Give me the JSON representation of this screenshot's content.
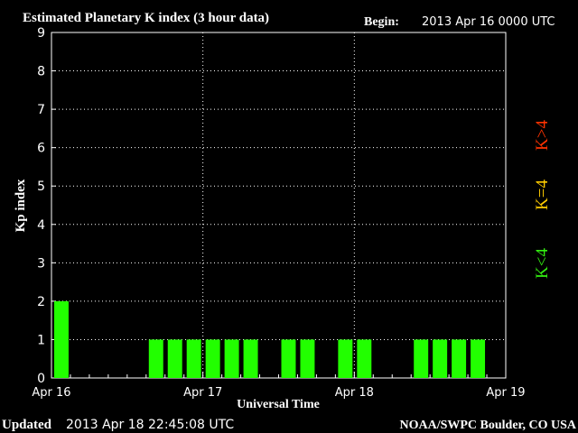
{
  "header": {
    "title": "Estimated Planetary K index (3 hour data)",
    "begin_label": "Begin:",
    "begin_value": "2013 Apr 16 0000 UTC"
  },
  "footer": {
    "updated_label": "Updated",
    "updated_value": "2013 Apr 18 22:45:08 UTC",
    "credit": "NOAA/SWPC Boulder, CO USA"
  },
  "legend": [
    {
      "label": "K>4",
      "color": "#ff3300"
    },
    {
      "label": "K=4",
      "color": "#ffcc00"
    },
    {
      "label": "K<4",
      "color": "#33ee11"
    }
  ],
  "colors": {
    "background": "#000000",
    "axes": "#ffffff",
    "grid": "#ffffff",
    "bar_low": "#22ff00"
  },
  "chart_data": {
    "type": "bar",
    "title": "Estimated Planetary K index (3 hour data)",
    "xlabel": "Universal Time",
    "ylabel": "Kp index",
    "ylim": [
      0,
      9
    ],
    "yticks": [
      "0",
      "1",
      "2",
      "3",
      "4",
      "5",
      "6",
      "7",
      "8",
      "9"
    ],
    "xticks": [
      "Apr 16",
      "Apr 17",
      "Apr 18",
      "Apr 19"
    ],
    "grid": true,
    "bins_per_day": 8,
    "values": [
      2,
      null,
      null,
      null,
      null,
      1,
      1,
      1,
      1,
      1,
      1,
      null,
      1,
      1,
      null,
      1,
      1,
      null,
      null,
      1,
      1,
      1,
      1,
      null
    ]
  }
}
